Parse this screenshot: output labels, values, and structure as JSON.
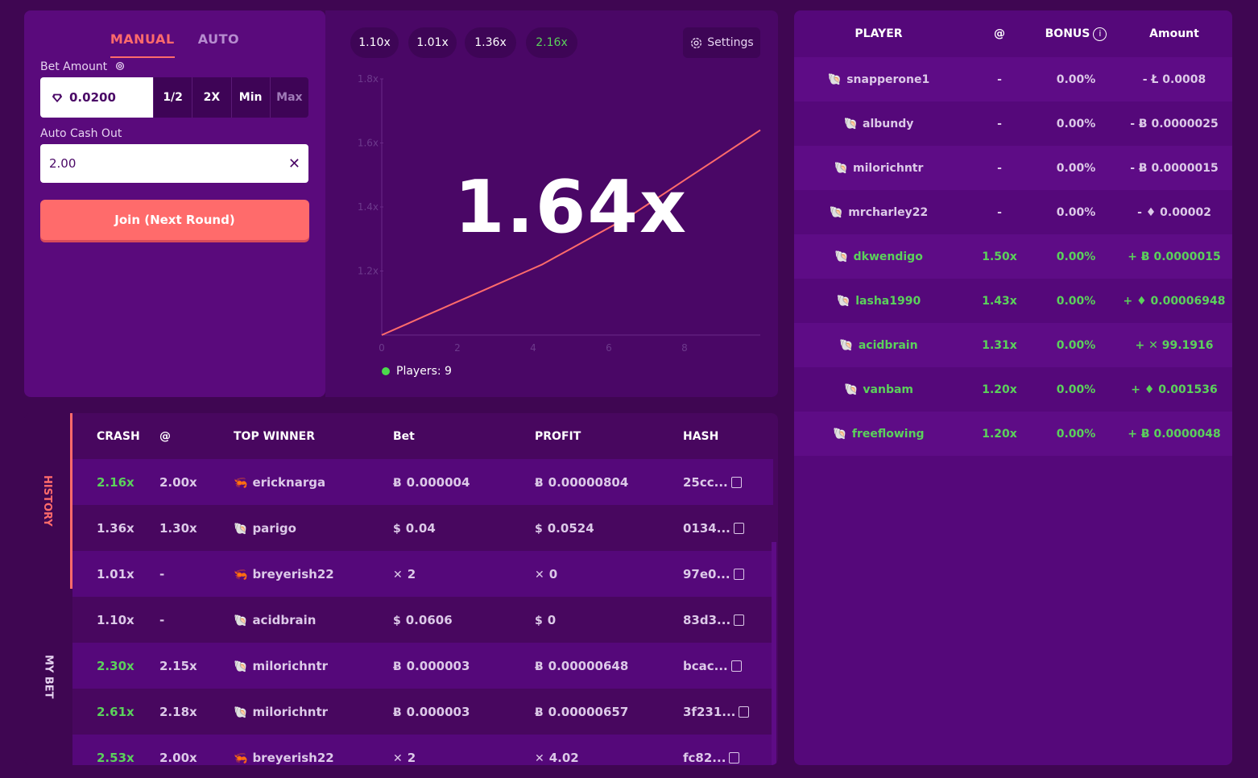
{
  "bet_panel": {
    "tabs": [
      "MANUAL",
      "AUTO"
    ],
    "active_tab": "MANUAL",
    "bet_amount_label": "Bet Amount",
    "bet_amount_value": "0.0200",
    "quick_buttons": [
      "1/2",
      "2X",
      "Min",
      "Max"
    ],
    "auto_cashout_label": "Auto Cash Out",
    "auto_cashout_value": "2.00",
    "join_button": "Join (Next Round)"
  },
  "game": {
    "recent_crashes": [
      "1.10x",
      "1.01x",
      "1.36x",
      "2.16x"
    ],
    "settings_label": "Settings",
    "multiplier": "1.64x",
    "players_label": "Players: 9"
  },
  "chart_data": {
    "type": "line",
    "x_ticks": [
      "0",
      "2",
      "4",
      "6",
      "8"
    ],
    "y_ticks": [
      "1.2x",
      "1.4x",
      "1.6x",
      "1.8x"
    ],
    "xlim": [
      0,
      10
    ],
    "ylim": [
      1.0,
      1.8
    ],
    "grid": false,
    "series": [
      {
        "x": [
          0,
          0.5,
          1,
          1.5,
          2,
          2.5,
          3,
          3.5,
          4,
          4.5,
          5,
          5.5,
          6,
          6.5,
          7,
          7.5,
          8,
          8.5,
          9,
          9.5,
          10,
          10.5,
          11,
          11.5,
          12,
          12.5,
          13
        ],
        "y": [
          1.0,
          1.02,
          1.04,
          1.06,
          1.08,
          1.1,
          1.12,
          1.14,
          1.16,
          1.18,
          1.2,
          1.22,
          1.245,
          1.27,
          1.295,
          1.32,
          1.345,
          1.37,
          1.4,
          1.43,
          1.46,
          1.49,
          1.52,
          1.55,
          1.58,
          1.61,
          1.64
        ]
      }
    ],
    "line_color": "#ff6b6b"
  },
  "players": {
    "headers": [
      "PLAYER",
      "@",
      "BONUS",
      "Amount"
    ],
    "rows": [
      {
        "name": "snapperone1",
        "at": "-",
        "bonus": "0.00%",
        "amount": "- Ł 0.0008",
        "win": false
      },
      {
        "name": "albundy",
        "at": "-",
        "bonus": "0.00%",
        "amount": "- Ƀ 0.0000025",
        "win": false
      },
      {
        "name": "milorichntr",
        "at": "-",
        "bonus": "0.00%",
        "amount": "- Ƀ 0.0000015",
        "win": false
      },
      {
        "name": "mrcharley22",
        "at": "-",
        "bonus": "0.00%",
        "amount": "- ♦ 0.00002",
        "win": false
      },
      {
        "name": "dkwendigo",
        "at": "1.50x",
        "bonus": "0.00%",
        "amount": "+ Ƀ 0.0000015",
        "win": true
      },
      {
        "name": "lasha1990",
        "at": "1.43x",
        "bonus": "0.00%",
        "amount": "+ ♦ 0.00006948",
        "win": true
      },
      {
        "name": "acidbrain",
        "at": "1.31x",
        "bonus": "0.00%",
        "amount": "+ ✕ 99.1916",
        "win": true
      },
      {
        "name": "vanbam",
        "at": "1.20x",
        "bonus": "0.00%",
        "amount": "+ ♦ 0.001536",
        "win": true
      },
      {
        "name": "freeflowing",
        "at": "1.20x",
        "bonus": "0.00%",
        "amount": "+ Ƀ 0.0000048",
        "win": true
      }
    ]
  },
  "history": {
    "side_tabs": [
      "HISTORY",
      "MY BET"
    ],
    "headers": [
      "CRASH",
      "@",
      "TOP WINNER",
      "Bet",
      "PROFIT",
      "HASH"
    ],
    "rows": [
      {
        "crash": "2.16x",
        "at": "2.00x",
        "winner": "ericknarga",
        "bet": "0.000004",
        "profit": "0.00000804",
        "hash": "25cc...",
        "green": true,
        "coin": "Ƀ",
        "avatar": "shrimp"
      },
      {
        "crash": "1.36x",
        "at": "1.30x",
        "winner": "parigo",
        "bet": "0.04",
        "profit": "0.0524",
        "hash": "0134...",
        "green": false,
        "coin": "$",
        "avatar": "shell"
      },
      {
        "crash": "1.01x",
        "at": "-",
        "winner": "breyerish22",
        "bet": "2",
        "profit": "0",
        "hash": "97e0...",
        "green": false,
        "coin": "✕",
        "avatar": "shrimp"
      },
      {
        "crash": "1.10x",
        "at": "-",
        "winner": "acidbrain",
        "bet": "0.0606",
        "profit": "0",
        "hash": "83d3...",
        "green": false,
        "coin": "$",
        "avatar": "shell"
      },
      {
        "crash": "2.30x",
        "at": "2.15x",
        "winner": "milorichntr",
        "bet": "0.000003",
        "profit": "0.00000648",
        "hash": "bcac...",
        "green": true,
        "coin": "Ƀ",
        "avatar": "shell"
      },
      {
        "crash": "2.61x",
        "at": "2.18x",
        "winner": "milorichntr",
        "bet": "0.000003",
        "profit": "0.00000657",
        "hash": "3f231...",
        "green": true,
        "coin": "Ƀ",
        "avatar": "shell"
      },
      {
        "crash": "2.53x",
        "at": "2.00x",
        "winner": "breyerish22",
        "bet": "2",
        "profit": "4.02",
        "hash": "fc82...",
        "green": true,
        "coin": "✕",
        "avatar": "shrimp"
      }
    ]
  }
}
